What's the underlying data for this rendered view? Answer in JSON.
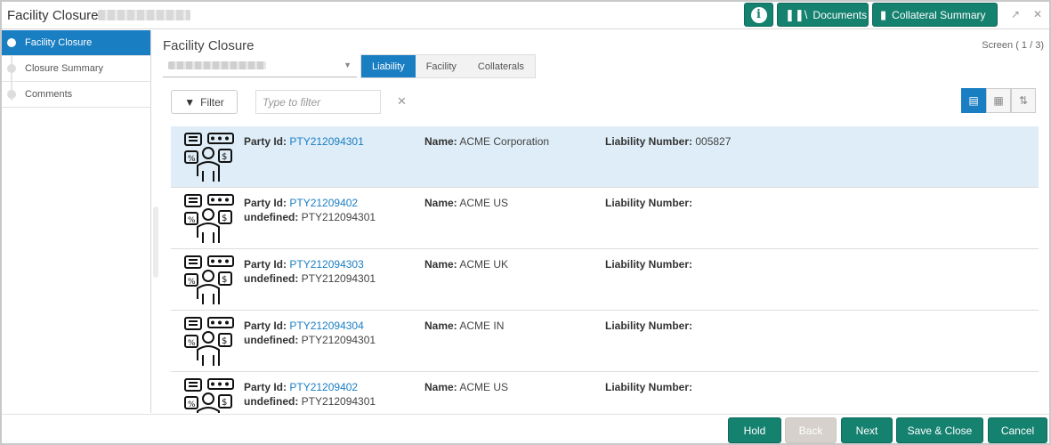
{
  "header": {
    "title": "Facility Closure",
    "documents_label": "Documents",
    "collateral_summary_label": "Collateral Summary"
  },
  "sidebar": {
    "items": [
      {
        "label": "Facility Closure",
        "active": true
      },
      {
        "label": "Closure Summary",
        "active": false
      },
      {
        "label": "Comments",
        "active": false
      }
    ]
  },
  "main": {
    "title": "Facility Closure",
    "screen_indicator": "Screen ( 1 / 3)",
    "tabs": [
      "Liability",
      "Facility",
      "Collaterals"
    ],
    "active_tab": "Liability",
    "filter_label": "Filter",
    "filter_placeholder": "Type to filter"
  },
  "list": {
    "labels": {
      "party": "Party Id:",
      "name": "Name:",
      "liability": "Liability Number:",
      "undefined": "undefined:"
    },
    "rows": [
      {
        "party_id": "PTY212094301",
        "name": "ACME Corporation",
        "liability_number": "005827",
        "undefined": ""
      },
      {
        "party_id": "PTY21209402",
        "name": "ACME US",
        "liability_number": "",
        "undefined": "PTY212094301"
      },
      {
        "party_id": "PTY212094303",
        "name": "ACME UK",
        "liability_number": "",
        "undefined": "PTY212094301"
      },
      {
        "party_id": "PTY212094304",
        "name": "ACME IN",
        "liability_number": "",
        "undefined": "PTY212094301"
      },
      {
        "party_id": "PTY21209402",
        "name": "ACME US",
        "liability_number": "",
        "undefined": "PTY212094301"
      }
    ]
  },
  "footer": {
    "hold": "Hold",
    "back": "Back",
    "next": "Next",
    "save_close": "Save & Close",
    "cancel": "Cancel"
  },
  "colors": {
    "primary_green": "#15816f",
    "accent_blue": "#1a7ec3",
    "selected_row": "#deedf7"
  }
}
